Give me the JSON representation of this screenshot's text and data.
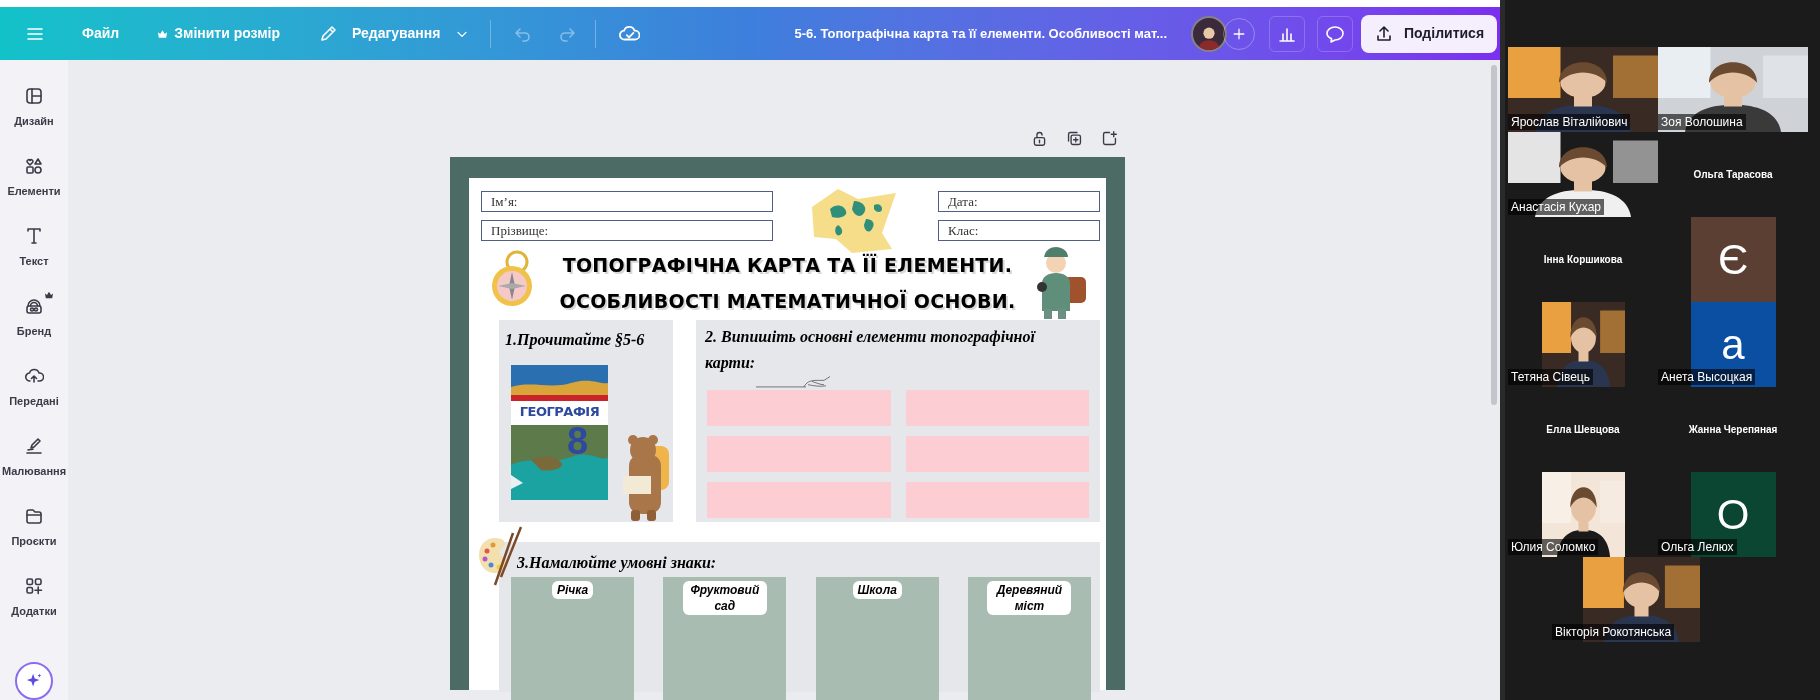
{
  "toolbar": {
    "items": [
      {
        "kind": "file",
        "label": "Файл"
      },
      {
        "kind": "resize",
        "label": "Змінити розмір"
      },
      {
        "kind": "edit",
        "label": "Редагування"
      }
    ],
    "history_buttons": [
      {
        "kind": "undo",
        "disabled": true
      },
      {
        "kind": "redo",
        "disabled": true
      }
    ],
    "document_title": "5-6. Топографічна карта та її елементи. Особливості мат...",
    "share_label": "Поділитися"
  },
  "sidebar": [
    {
      "kind": "design",
      "label": "Дизайн"
    },
    {
      "kind": "elements",
      "label": "Елементи"
    },
    {
      "kind": "text",
      "label": "Текст"
    },
    {
      "kind": "brand",
      "label": "Бренд"
    },
    {
      "kind": "uploads",
      "label": "Передані"
    },
    {
      "kind": "draw",
      "label": "Малювання"
    },
    {
      "kind": "projects",
      "label": "Проєкти"
    },
    {
      "kind": "apps",
      "label": "Додатки"
    }
  ],
  "worksheet": {
    "fields_left": [
      "Ім’я:",
      "Прізвище:"
    ],
    "fields_right": [
      "Дата:",
      "Клас:"
    ],
    "title_lines": [
      "ТОПОГРАФІЧНА КАРТА ТА ЇЇ ЕЛЕМЕНТИ.",
      "ОСОБЛИВОСТІ МАТЕМАТИЧНОЇ ОСНОВИ."
    ],
    "task1": "1.Прочитайте §5-6",
    "book": {
      "title": "ГЕОГРАФІЯ",
      "grade": "8"
    },
    "task2": "2. Випишіть основні елементи топографічної карти:",
    "task3": "3.Намалюйте умовні знаки:",
    "signs": [
      "Річка",
      "Фруктовий сад",
      "Школа",
      "Деревяний міст"
    ]
  },
  "participants": [
    {
      "kind": "video",
      "name": "Ярослав Віталійович"
    },
    {
      "kind": "video",
      "name": "Зоя Волошина"
    },
    {
      "kind": "video",
      "name": "Анастасія Кухар"
    },
    {
      "kind": "name_only",
      "name": "Ольга Тарасова"
    },
    {
      "kind": "name_only",
      "name": "Інна Коршикова"
    },
    {
      "kind": "letter",
      "letter": "Є",
      "color": "#5b3f33"
    },
    {
      "name": "Тетяна Сівець"
    },
    {
      "kind": "letter",
      "letter": "a",
      "color": "#0b4fa3",
      "name": "Анета Высоцкая"
    },
    {
      "kind": "name_only",
      "name": "Елла Шевцова"
    },
    {
      "kind": "name_only",
      "name": "Жанна Черепяная"
    },
    {
      "name": "Юлия Соломко"
    },
    {
      "kind": "letter",
      "letter": "O",
      "color": "#0b4633",
      "name": "Ольга Лелюх"
    },
    {
      "name": "Вікторія Рокотянська"
    }
  ]
}
